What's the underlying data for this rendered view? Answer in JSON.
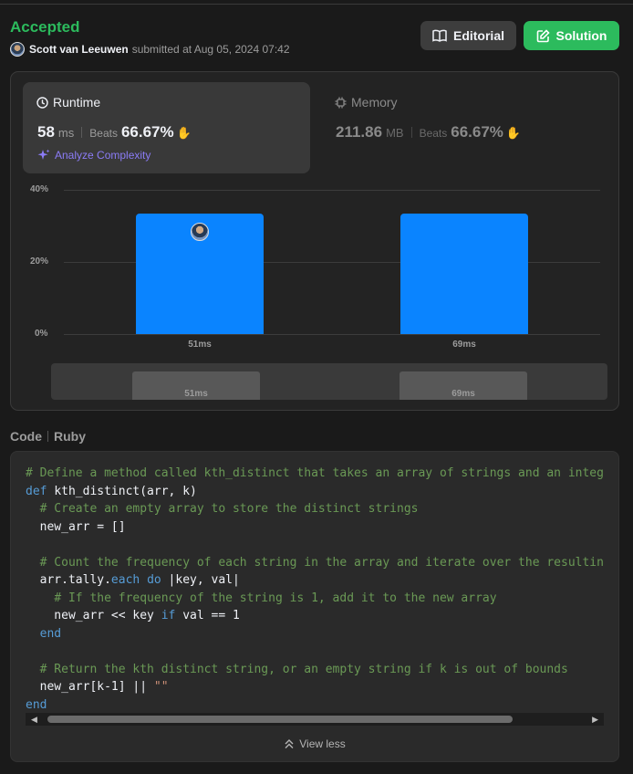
{
  "header": {
    "status": "Accepted",
    "user": "Scott van Leeuwen",
    "submitted_text": "submitted at Aug 05, 2024 07:42",
    "editorial_label": "Editorial",
    "solution_label": "Solution"
  },
  "runtime": {
    "title": "Runtime",
    "value": "58",
    "unit": "ms",
    "beats_label": "Beats",
    "beats_pct": "66.67%",
    "analyze_label": "Analyze Complexity"
  },
  "memory": {
    "title": "Memory",
    "value": "211.86",
    "unit": "MB",
    "beats_label": "Beats",
    "beats_pct": "66.67%"
  },
  "chart_data": {
    "type": "bar",
    "categories": [
      "51ms",
      "69ms"
    ],
    "values": [
      33.33,
      33.33
    ],
    "ylim": [
      0,
      40
    ],
    "yticks": [
      "0%",
      "20%",
      "40%"
    ],
    "bar_color": "#0a84ff",
    "grid": true,
    "brush_labels": [
      "51ms",
      "69ms"
    ]
  },
  "code": {
    "header_label": "Code",
    "language": "Ruby",
    "view_less_label": "View less"
  },
  "colors": {
    "accepted": "#2cbb5d",
    "accent_purple": "#8b7cf6",
    "bar_blue": "#0a84ff"
  },
  "icons": {
    "editorial": "book-icon",
    "solution": "edit-icon",
    "runtime": "clock-icon",
    "memory": "chip-icon",
    "analyze": "sparkle-icon",
    "view_less": "double-chevron-up-icon"
  }
}
